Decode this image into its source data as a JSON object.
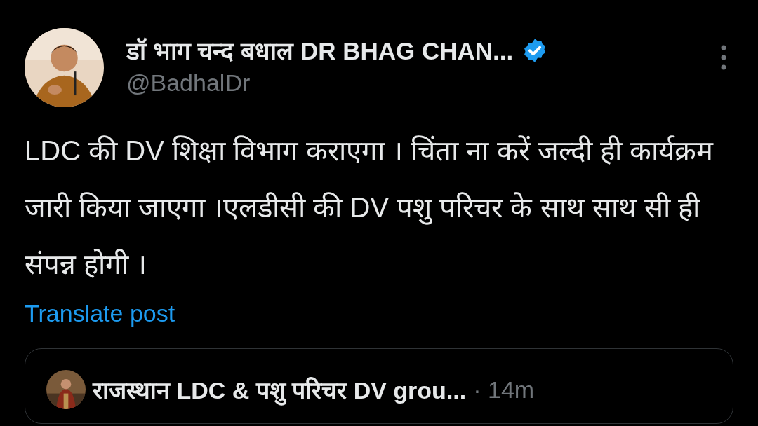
{
  "post": {
    "author_name": "डॉ भाग चन्द बधाल DR BHAG CHAN...",
    "verified": true,
    "handle": "@BadhalDr",
    "text": "LDC की DV शिक्षा विभाग कराएगा । चिंता ना करें जल्दी ही कार्यक्रम जारी किया जाएगा ।एलडीसी की DV पशु परिचर के साथ साथ सी ही संपन्न होगी ।",
    "translate_link": "Translate post",
    "quoted_post": {
      "author_name": "राजस्थान LDC & पशु परिचर DV grou...",
      "time": "· 14m"
    }
  }
}
